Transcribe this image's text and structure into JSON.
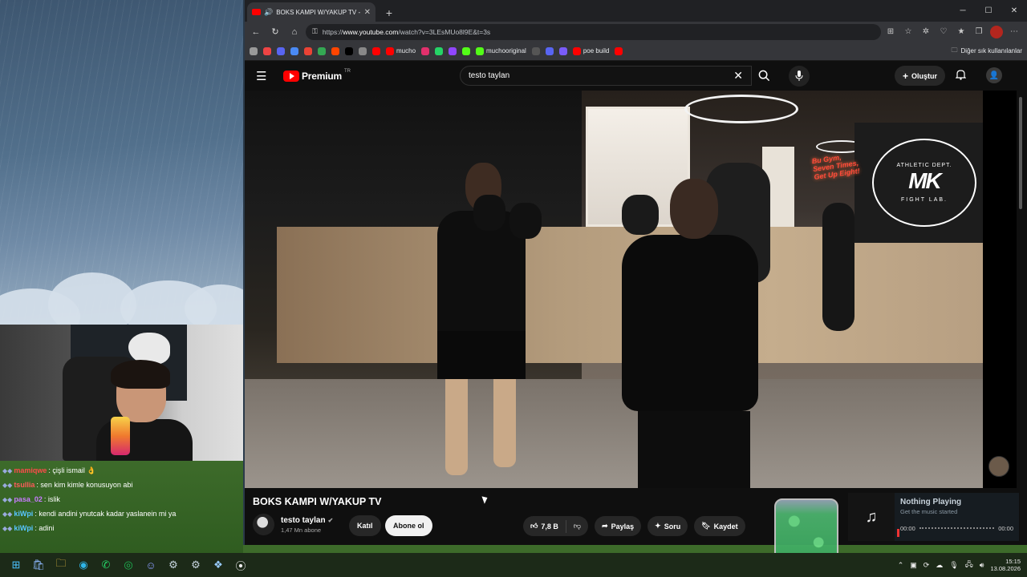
{
  "chat": [
    {
      "user": "mamiqwe",
      "user_color": "#ff4b4b",
      "message": ": çişli ismail 👌"
    },
    {
      "user": "tsullia",
      "user_color": "#ff5a5a",
      "message": ": sen kim kimle konusuyon abi"
    },
    {
      "user": "pasa_02",
      "user_color": "#c87bff",
      "message": ": islik"
    },
    {
      "user": "kiWpi",
      "user_color": "#57c5ff",
      "message": ": kendi andini ynutcak kadar yaslanein mi ya"
    },
    {
      "user": "kiWpi",
      "user_color": "#57c5ff",
      "message": ": adini"
    }
  ],
  "browser": {
    "tab_title": "BOKS KAMPI W/YAKUP TV - Y",
    "url_prefix": "https://",
    "url_host": "www.youtube.com",
    "url_path": "/watch?v=3LEsMUo8l9E&t=3s",
    "bookmarks": [
      {
        "label": "",
        "color": "#999"
      },
      {
        "label": "",
        "color": "#e44"
      },
      {
        "label": "",
        "color": "#5865f2"
      },
      {
        "label": "",
        "color": "#4a8af4"
      },
      {
        "label": "",
        "color": "#ea4335"
      },
      {
        "label": "",
        "color": "#34a853"
      },
      {
        "label": "",
        "color": "#ff4500"
      },
      {
        "label": "",
        "color": "#000"
      },
      {
        "label": "",
        "color": "#888"
      },
      {
        "label": "",
        "color": "#ff0000"
      },
      {
        "label": "mucho",
        "color": "#ff0000"
      },
      {
        "label": "",
        "color": "#e1306c"
      },
      {
        "label": "",
        "color": "#25d366"
      },
      {
        "label": "",
        "color": "#9146ff"
      },
      {
        "label": "",
        "color": "#53fc18"
      },
      {
        "label": "muchooriginal",
        "color": "#53fc18"
      },
      {
        "label": "",
        "color": "#555"
      },
      {
        "label": "",
        "color": "#5865f2"
      },
      {
        "label": "",
        "color": "#7a5cfa"
      },
      {
        "label": "poe build",
        "color": "#ff0000"
      },
      {
        "label": "",
        "color": "#ff0000"
      }
    ],
    "other_bookmarks": "Diğer sık kullanılanlar"
  },
  "youtube": {
    "logo_text": "Premium",
    "logo_sup": "TR",
    "search_query": "testo taylan",
    "create_label": "Oluştur",
    "video_title": "BOKS KAMPI W/YAKUP TV",
    "channel_name": "testo taylan",
    "subscribers": "1,47 Mn abone",
    "join_label": "Katıl",
    "subscribe_label": "Abone ol",
    "likes": "7,8 B",
    "share_label": "Paylaş",
    "ask_label": "Soru",
    "save_label": "Kaydet",
    "neon_text": "Bu Gym, Seven Times, Get Up Eight!",
    "logo_mk": "MK",
    "logo_top": "ATHLETIC DEPT.",
    "logo_bottom": "FIGHT LAB."
  },
  "music": {
    "title": "Nothing Playing",
    "subtitle": "Get the music started",
    "time_start": "00:00",
    "time_end": "00:00"
  },
  "taskbar": {
    "time": "15:15",
    "date": "13.08.2026"
  }
}
